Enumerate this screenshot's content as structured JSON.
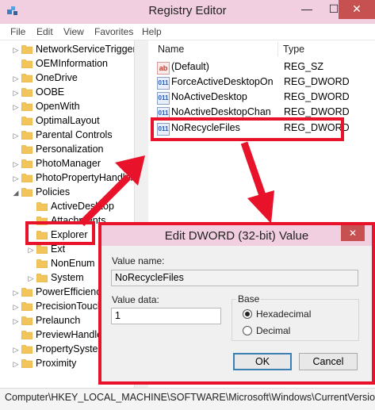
{
  "window": {
    "title": "Registry Editor",
    "minimize_glyph": "—",
    "maximize_glyph": "☐",
    "close_glyph": "✕"
  },
  "menu": [
    "File",
    "Edit",
    "View",
    "Favorites",
    "Help"
  ],
  "tree": {
    "items": [
      {
        "label": "NetworkServiceTrigger",
        "expander": "▷",
        "level": 1
      },
      {
        "label": "OEMInformation",
        "expander": "",
        "level": 1
      },
      {
        "label": "OneDrive",
        "expander": "▷",
        "level": 1
      },
      {
        "label": "OOBE",
        "expander": "▷",
        "level": 1
      },
      {
        "label": "OpenWith",
        "expander": "▷",
        "level": 1
      },
      {
        "label": "OptimalLayout",
        "expander": "",
        "level": 1
      },
      {
        "label": "Parental Controls",
        "expander": "▷",
        "level": 1
      },
      {
        "label": "Personalization",
        "expander": "",
        "level": 1
      },
      {
        "label": "PhotoManager",
        "expander": "▷",
        "level": 1
      },
      {
        "label": "PhotoPropertyHandler",
        "expander": "▷",
        "level": 1
      },
      {
        "label": "Policies",
        "expander": "◢",
        "level": 1
      },
      {
        "label": "ActiveDesktop",
        "expander": "",
        "level": 2
      },
      {
        "label": "Attachments",
        "expander": "",
        "level": 2
      },
      {
        "label": "Explorer",
        "expander": "",
        "level": 2
      },
      {
        "label": "Ext",
        "expander": "▷",
        "level": 2
      },
      {
        "label": "NonEnum",
        "expander": "",
        "level": 2
      },
      {
        "label": "System",
        "expander": "▷",
        "level": 2
      },
      {
        "label": "PowerEfficiency",
        "expander": "▷",
        "level": 1
      },
      {
        "label": "PrecisionTouch",
        "expander": "▷",
        "level": 1
      },
      {
        "label": "Prelaunch",
        "expander": "▷",
        "level": 1
      },
      {
        "label": "PreviewHandlers",
        "expander": "",
        "level": 1
      },
      {
        "label": "PropertySystem",
        "expander": "▷",
        "level": 1
      },
      {
        "label": "Proximity",
        "expander": "▷",
        "level": 1
      }
    ]
  },
  "values_pane": {
    "columns": {
      "name": "Name",
      "type": "Type"
    },
    "rows": [
      {
        "name": "(Default)",
        "type": "REG_SZ",
        "icon": "ab"
      },
      {
        "name": "ForceActiveDesktopOn",
        "type": "REG_DWORD",
        "icon": "011"
      },
      {
        "name": "NoActiveDesktop",
        "type": "REG_DWORD",
        "icon": "011"
      },
      {
        "name": "NoActiveDesktopChan",
        "type": "REG_DWORD",
        "icon": "011"
      },
      {
        "name": "NoRecycleFiles",
        "type": "REG_DWORD",
        "icon": "011"
      }
    ]
  },
  "dialog": {
    "title": "Edit DWORD (32-bit) Value",
    "close_glyph": "✕",
    "value_name_label": "Value name:",
    "value_name": "NoRecycleFiles",
    "value_data_label": "Value data:",
    "value_data": "1",
    "base_label": "Base",
    "hex_label": "Hexadecimal",
    "dec_label": "Decimal",
    "base_selected": "Hexadecimal",
    "ok_label": "OK",
    "cancel_label": "Cancel"
  },
  "status": {
    "path": "Computer\\HKEY_LOCAL_MACHINE\\SOFTWARE\\Microsoft\\Windows\\CurrentVersion"
  },
  "colors": {
    "highlight": "#e8132a",
    "titlebar": "#f2cfe0",
    "folder": "#f2c55a"
  }
}
